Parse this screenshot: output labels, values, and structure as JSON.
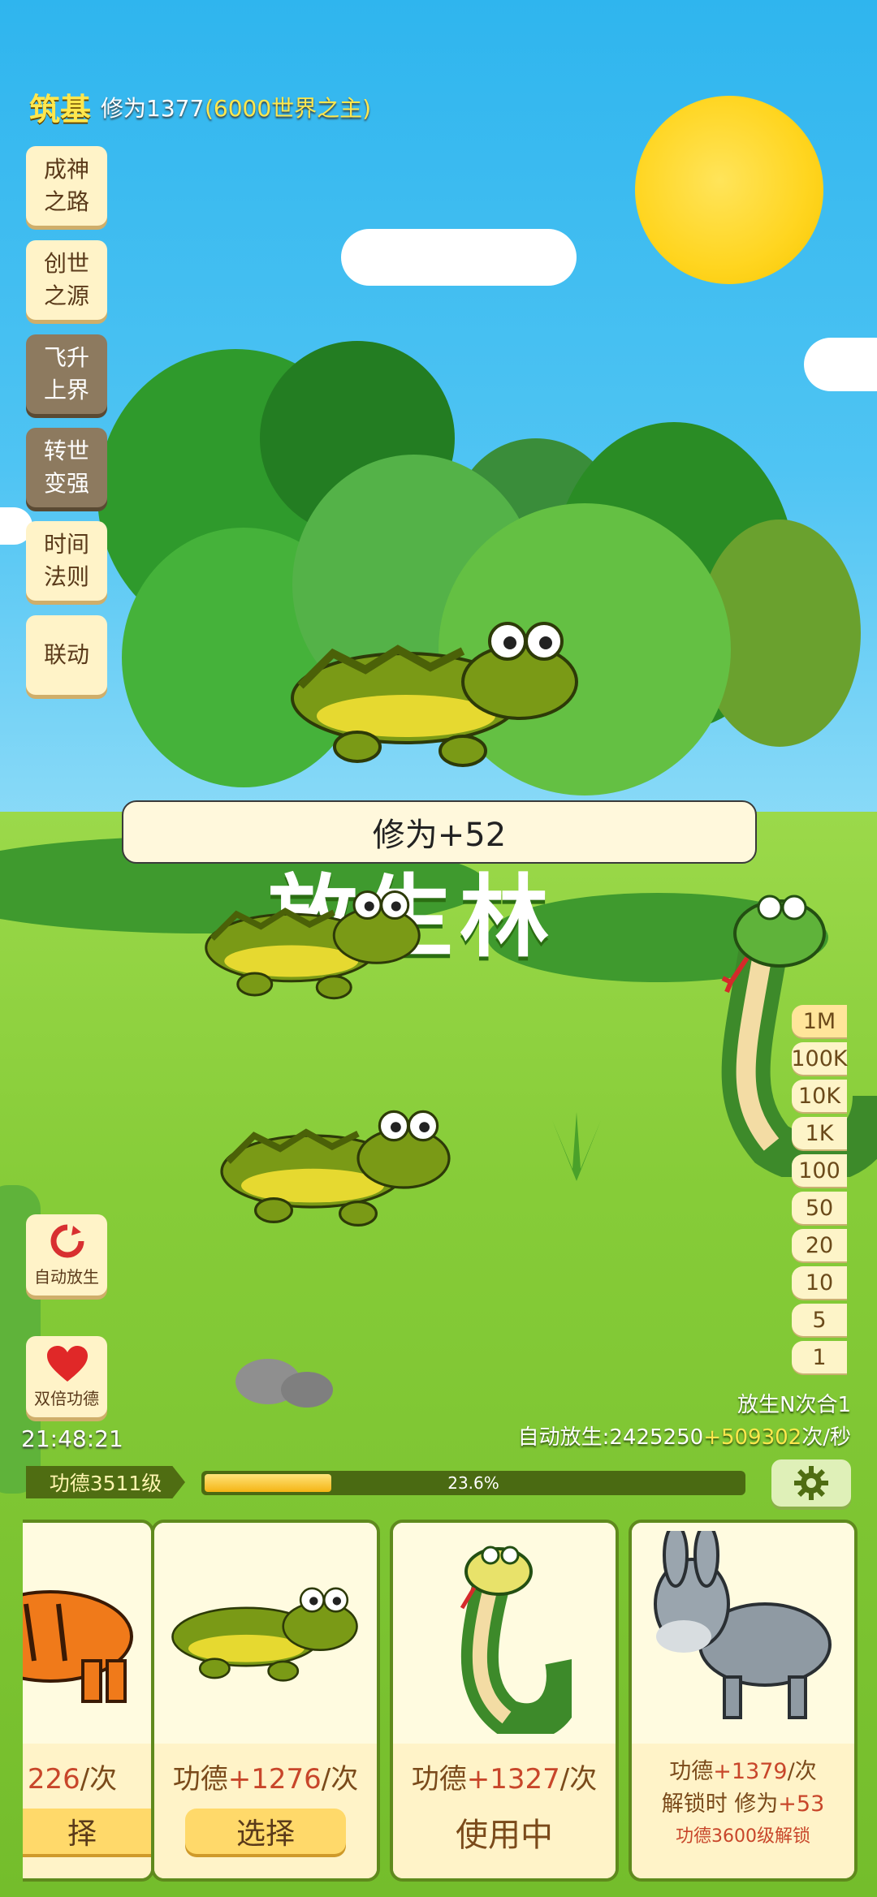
{
  "hud": {
    "realm": "筑基",
    "cultivation": "修为1377",
    "cultivation_note": "(6000世界之主)"
  },
  "menu": [
    {
      "label": "成神\n之路",
      "style": "light"
    },
    {
      "label": "创世\n之源",
      "style": "light"
    },
    {
      "label": "飞升\n上界",
      "style": "dark"
    },
    {
      "label": "转世\n变强",
      "style": "dark"
    },
    {
      "label": "时间\n法则",
      "style": "light"
    },
    {
      "label": "联动",
      "style": "light"
    }
  ],
  "banner": {
    "toast": "修为+52",
    "background_title": "放生林"
  },
  "multipliers": [
    "1M",
    "100K",
    "10K",
    "1K",
    "100",
    "50",
    "20",
    "10",
    "5",
    "1"
  ],
  "side_buttons": {
    "auto_release": "自动放生",
    "double_merit": "双倍功德"
  },
  "clock": "21:48:21",
  "release_mode": "放生N次合1",
  "auto_release": {
    "prefix": "自动放生:",
    "base": "2425250",
    "bonus": "+509302",
    "suffix": "次/秒"
  },
  "progress": {
    "level_label": "功德3511级",
    "percent_text": "23.6%",
    "fraction": 0.236
  },
  "cards": [
    {
      "animal": "tiger",
      "merit_value": "226",
      "merit_suffix": "/次",
      "button": "择"
    },
    {
      "animal": "crocodile",
      "merit_prefix": "功德",
      "merit_value": "+1276",
      "merit_suffix": "/次",
      "button": "选择"
    },
    {
      "animal": "snake",
      "merit_prefix": "功德",
      "merit_value": "+1327",
      "merit_suffix": "/次",
      "status": "使用中"
    },
    {
      "animal": "donkey",
      "merit_prefix": "功德",
      "merit_value": "+1379",
      "merit_suffix": "/次",
      "unlock_prefix": "解锁时 修为",
      "unlock_value": "+53",
      "requirement": "功德3600级解锁"
    }
  ],
  "colors": {
    "sky": "#4fc4f3",
    "grass": "#86cc38",
    "accent_yellow": "#ffe74d",
    "progress_fill": "#f5b514"
  }
}
